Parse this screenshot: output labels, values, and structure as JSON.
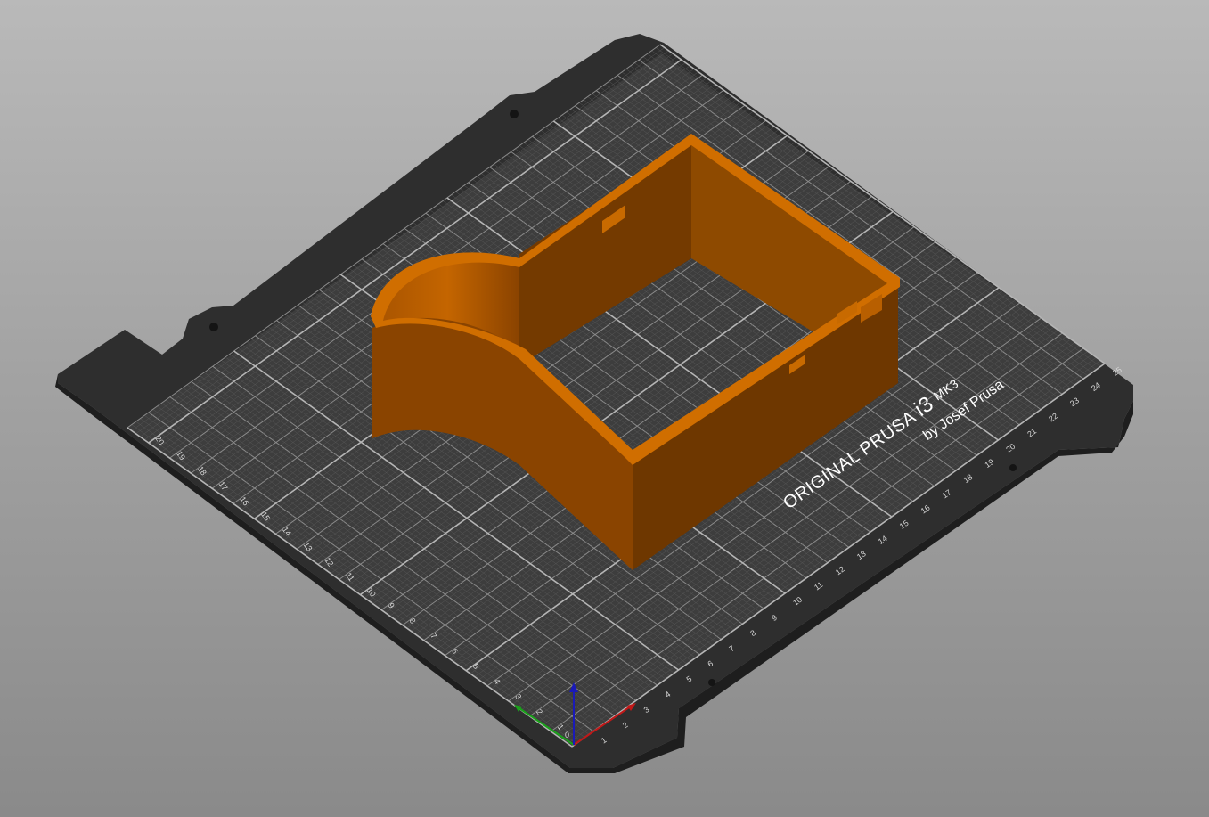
{
  "bed": {
    "brand_title": "ORIGINAL PRUSA",
    "brand_model": "i3",
    "brand_variant": "MK3",
    "brand_by": "by Josef Prusa",
    "x_ticks": [
      "1",
      "2",
      "3",
      "4",
      "5",
      "6",
      "7",
      "8",
      "9",
      "10",
      "11",
      "12",
      "13",
      "14",
      "15",
      "16",
      "17",
      "18",
      "19",
      "20",
      "21",
      "22",
      "23",
      "24",
      "25"
    ],
    "y_ticks": [
      "1",
      "2",
      "3",
      "4",
      "5",
      "6",
      "7",
      "8",
      "9",
      "10",
      "11",
      "12",
      "13",
      "14",
      "15",
      "16",
      "17",
      "18",
      "19",
      "20"
    ],
    "origin_label": "0"
  },
  "model": {
    "color": "#c86a00"
  },
  "axes": {
    "x_color": "#c01818",
    "y_color": "#1aa11a",
    "z_color": "#1a1ab8"
  }
}
